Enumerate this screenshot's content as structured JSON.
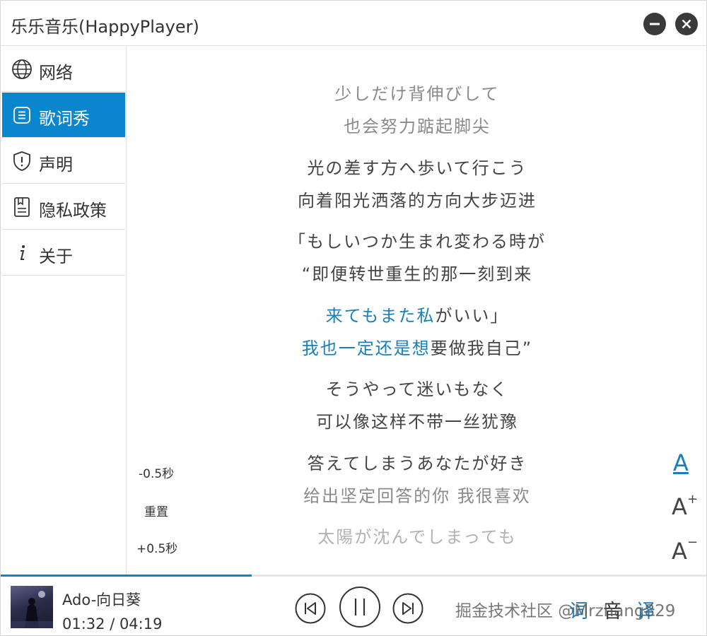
{
  "window": {
    "title": "乐乐音乐(HappyPlayer)"
  },
  "sidebar": {
    "items": [
      {
        "label": "网络",
        "icon": "globe-icon",
        "active": false
      },
      {
        "label": "歌词秀",
        "icon": "lyrics-icon",
        "active": true
      },
      {
        "label": "声明",
        "icon": "shield-icon",
        "active": false
      },
      {
        "label": "隐私政策",
        "icon": "document-icon",
        "active": false
      },
      {
        "label": "关于",
        "icon": "info-icon",
        "active": false
      }
    ]
  },
  "lyrics": {
    "lines": [
      {
        "text": "少しだけ背伸びして"
      },
      {
        "text": "也会努力踮起脚尖"
      },
      {
        "text": "光の差す方へ歩いて行こう"
      },
      {
        "text": "向着阳光洒落的方向大步迈进"
      },
      {
        "text": "「もしいつか生まれ変わる時が"
      },
      {
        "text": "“即便转世重生的那一刻到来"
      },
      {
        "highlighted": "来てもまた私",
        "rest": "がいい」"
      },
      {
        "highlighted": "我也一定还是想",
        "rest": "要做我自己”"
      },
      {
        "text": "そうやって迷いもなく"
      },
      {
        "text": "可以像这样不带一丝犹豫"
      },
      {
        "text": "答えてしまうあなたが好き"
      },
      {
        "text": "给出坚定回答的你 我很喜欢"
      },
      {
        "text": "太陽が沈んでしまっても"
      }
    ],
    "offset_controls": {
      "minus": "-0.5秒",
      "reset": "重置",
      "plus": "+0.5秒"
    },
    "font_controls": {
      "default": "A",
      "increase": "A",
      "increase_sign": "+",
      "decrease": "A",
      "decrease_sign": "−"
    }
  },
  "player": {
    "song_title": "Ado-向日葵",
    "time": "01:32 / 04:19",
    "progress": 0.356,
    "modes": {
      "lyrics": "词",
      "sound": "音",
      "translate": "译"
    },
    "watermark": "掘金技术社区 @Mrzhang829"
  },
  "colors": {
    "accent": "#0a86cf",
    "highlight_text": "#1a7fb8"
  }
}
